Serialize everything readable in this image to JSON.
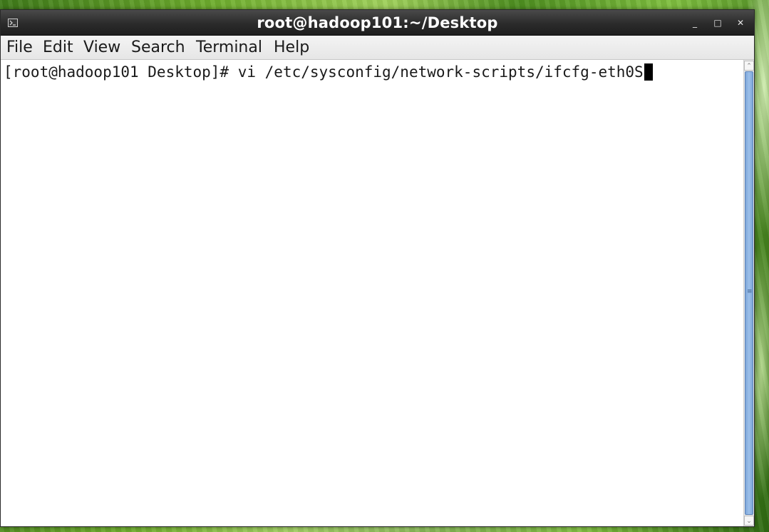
{
  "window": {
    "title": "root@hadoop101:~/Desktop",
    "minimize_glyph": "_",
    "maximize_glyph": "□",
    "close_glyph": "✕",
    "app_icon": "terminal-icon"
  },
  "menubar": {
    "items": [
      {
        "label": "File"
      },
      {
        "label": "Edit"
      },
      {
        "label": "View"
      },
      {
        "label": "Search"
      },
      {
        "label": "Terminal"
      },
      {
        "label": "Help"
      }
    ]
  },
  "terminal": {
    "prompt": "[root@hadoop101 Desktop]# ",
    "command": "vi /etc/sysconfig/network-scripts/ifcfg-eth0S"
  },
  "scrollbar": {
    "up_glyph": "⌃",
    "down_glyph": "⌄",
    "grip_glyph": "≡"
  },
  "colors": {
    "titlebar": "#2b2b2b",
    "scroll_thumb": "#8fb3e0",
    "desktop": "#6fae2e"
  }
}
